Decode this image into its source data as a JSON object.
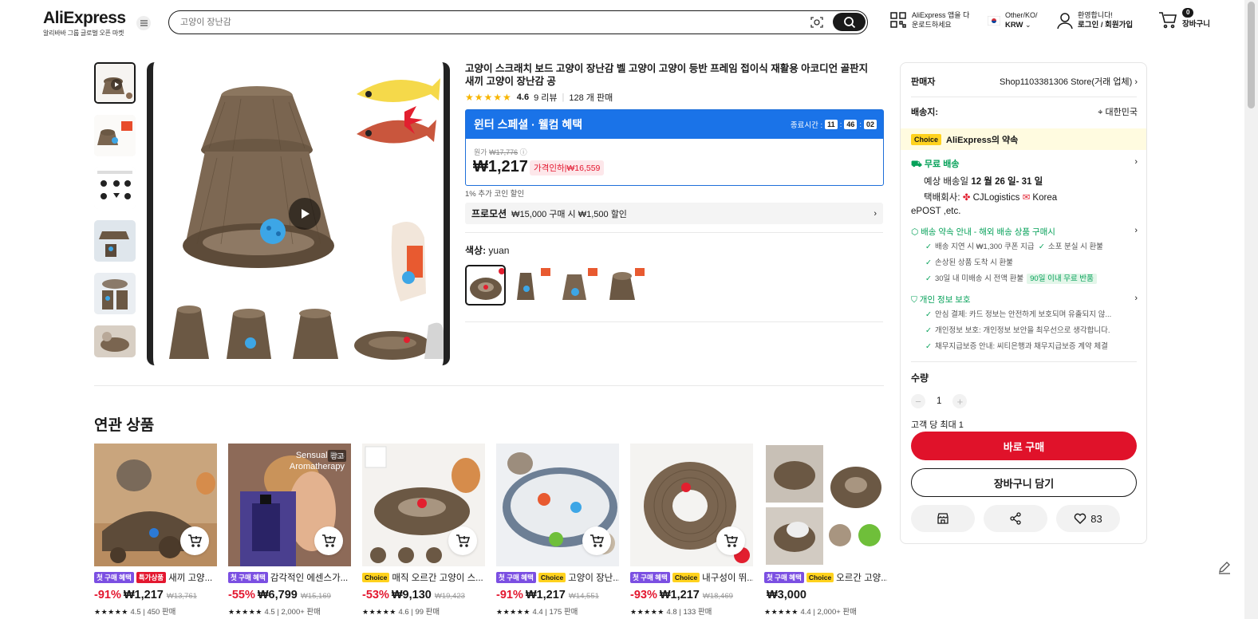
{
  "header": {
    "logo": "AliExpress",
    "logo_sub": "알리바바 그룹 글로벌 오픈 마켓",
    "search_placeholder": "고양이 장난감",
    "app_line1": "AliExpress 앱을 다",
    "app_line2": "운로드하세요",
    "region_line1": "Other/KO/",
    "region_line2": "KRW",
    "user_line1": "환영합니다!",
    "user_line2": "로그인 / 회원가입",
    "cart_count": "0",
    "cart_label": "장바구니"
  },
  "product": {
    "title": "고양이 스크래치 보드 고양이 장난감 벨 고양이 고양이 등반 프레임 접이식 재활용 아코디언 골판지 새끼 고양이 장난감 공",
    "rating": "4.6",
    "reviews": "9 리뷰",
    "sold": "128 개 판매",
    "promo_title": "윈터 스페셜 · 웰컴 혜택",
    "timer_label": "종료시간 :",
    "timer_h": "11",
    "timer_m": "46",
    "timer_s": "02",
    "orig_label": "원가",
    "orig_price": "₩17,776",
    "price": "₩1,217",
    "price_drop": "가격인하|₩16,559",
    "coin_text": "1% 추가 코인 할인",
    "promotion_label": "프로모션",
    "promotion_text": "₩15,000 구매 시 ₩1,500 할인",
    "color_label": "색상:",
    "color_value": "yuan"
  },
  "panel": {
    "seller_label": "판매자",
    "seller_name": "Shop1103381306 Store(거래 업체)",
    "ship_to_label": "배송지:",
    "ship_to_value": "대한민국",
    "choice_tag": "Choice",
    "choice_promise": "AliExpress의 약속",
    "free_shipping": "무료 배송",
    "delivery_prefix": "예상 배송일",
    "delivery_dates": "12 월 26 일- 31 일",
    "carrier_label": "택배회사:",
    "carrier_1": "CJLogistics",
    "carrier_2": "Korea",
    "carrier_3": "ePOST ,etc.",
    "promise_title": "배송 약속 안내 - 해외 배송 상품 구매시",
    "promise_1": "배송 지연 시 ₩1,300 쿠폰 지급",
    "promise_2": "소포 분실 시 환불",
    "promise_3": "손상된 상품 도착 시 환불",
    "promise_4": "30일 내 미배송 시 전액 환불",
    "promise_badge": "90일 이내 무료 반품",
    "privacy_title": "개인 정보 보호",
    "privacy_1": "안심 결제: 카드 정보는 안전하게 보호되며 유출되지 않...",
    "privacy_2": "개인정보 보호: 개인정보 보안을 최우선으로 생각합니다.",
    "privacy_3": "채무지급보증 안내: 씨티은행과 채무지급보증 계약 체결",
    "qty_label": "수량",
    "qty_value": "1",
    "qty_limit": "고객 당 최대 1",
    "buy_now": "바로 구매",
    "add_to_cart": "장바구니 담기",
    "wishlist_count": "83"
  },
  "related": {
    "title": "연관 상품",
    "items": [
      {
        "tags": [
          "첫 구매 혜택",
          "특가상품"
        ],
        "name": "새끼 고양...",
        "disc": "-91%",
        "price": "₩1,217",
        "orig": "₩13,761",
        "rating": "4.5",
        "sold": "450 판매"
      },
      {
        "tags": [
          "첫 구매 혜택"
        ],
        "name": "감각적인 에센스가...",
        "disc": "-55%",
        "price": "₩6,799",
        "orig": "₩15,169",
        "rating": "4.5",
        "sold": "2,000+ 판매",
        "ad": "광고",
        "ad_text_1": "Sensual Ess",
        "ad_text_2": "Aromatherapy"
      },
      {
        "tags": [
          "Choice"
        ],
        "name": "매직 오르간 고양이 스...",
        "disc": "-53%",
        "price": "₩9,130",
        "orig": "₩19,423",
        "rating": "4.6",
        "sold": "99 판매"
      },
      {
        "tags": [
          "첫 구매 혜택",
          "Choice"
        ],
        "name": "고양이 장난...",
        "disc": "-91%",
        "price": "₩1,217",
        "orig": "₩14,551",
        "rating": "4.4",
        "sold": "175 판매"
      },
      {
        "tags": [
          "첫 구매 혜택",
          "Choice"
        ],
        "name": "내구성이 뛰...",
        "disc": "-93%",
        "price": "₩1,217",
        "orig": "₩18,469",
        "rating": "4.8",
        "sold": "133 판매"
      },
      {
        "tags": [
          "첫 구매 혜택",
          "Choice"
        ],
        "name": "오르간 고양...",
        "disc": "",
        "price": "₩3,000",
        "orig": "",
        "rating": "4.4",
        "sold": "2,000+ 판매"
      }
    ]
  },
  "colors": {
    "accent": "#e0122a",
    "blue": "#1a73e8",
    "green": "#05a159",
    "choice": "#ffd21e"
  }
}
